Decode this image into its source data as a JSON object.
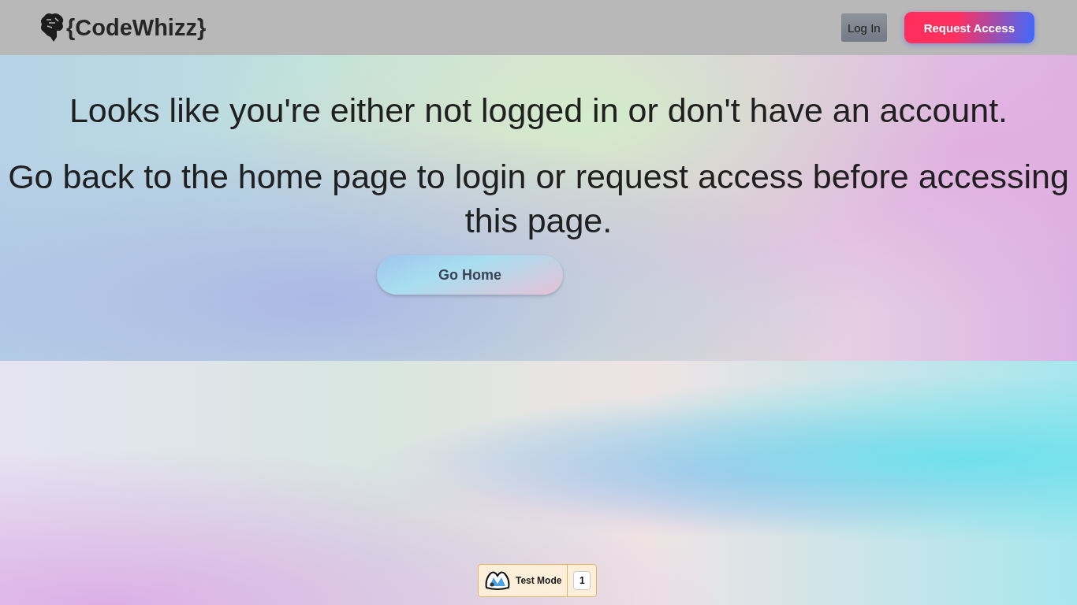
{
  "header": {
    "logo": "{CodeWhizz}",
    "buttons": [
      {
        "label": "Log In",
        "kind": "plain"
      },
      {
        "label": "Request Access",
        "kind": "primary"
      }
    ]
  },
  "message": {
    "lines": [
      "Looks like you're either not logged in or don't have an account.",
      "Go back to the home page to login or request access before accessing this page."
    ],
    "button": "Go Home"
  },
  "test_badge": {
    "label": "Test Mode",
    "count": "1"
  }
}
